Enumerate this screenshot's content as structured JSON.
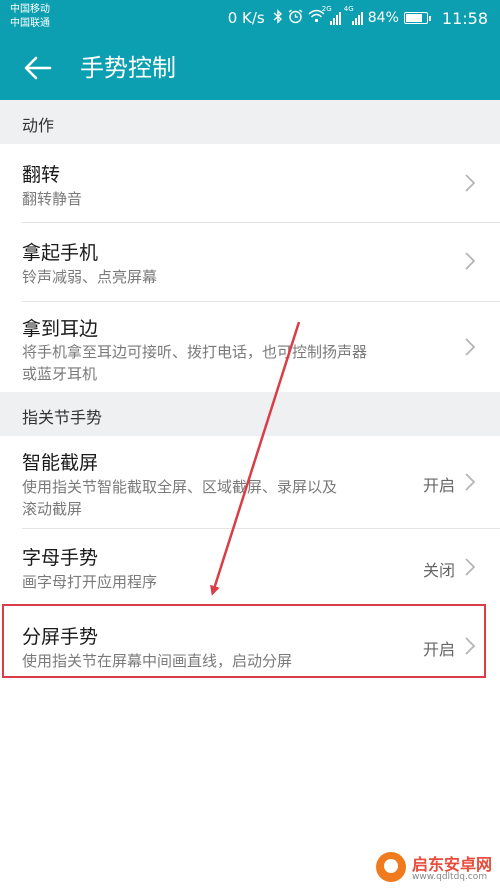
{
  "status_bar": {
    "carrier_1": "中国移动",
    "carrier_2": "中国联通",
    "speed": "0 K/s",
    "net_2g": "2G",
    "net_4g": "4G",
    "battery_percent": "84%",
    "battery_level": 0.84,
    "time": "11:58",
    "icons": [
      "bluetooth-icon",
      "alarm-icon",
      "wifi-icon",
      "signal-icon",
      "battery-icon"
    ]
  },
  "header": {
    "title": "手势控制",
    "background": "#0c9fb1"
  },
  "sections": [
    {
      "header": "动作",
      "items": [
        {
          "title": "翻转",
          "subtitle": "翻转静音"
        },
        {
          "title": "拿起手机",
          "subtitle": "铃声减弱、点亮屏幕"
        },
        {
          "title": "拿到耳边",
          "subtitle_line1": "将手机拿至耳边可接听、拨打电话，也可控制扬声器",
          "subtitle_line2": "或蓝牙耳机"
        }
      ]
    },
    {
      "header": "指关节手势",
      "items": [
        {
          "title": "智能截屏",
          "subtitle_line1": "使用指关节智能截取全屏、区域截屏、录屏以及",
          "subtitle_line2": "滚动截屏",
          "value": "开启"
        },
        {
          "title": "字母手势",
          "subtitle": "画字母打开应用程序",
          "value": "关闭"
        },
        {
          "title": "分屏手势",
          "subtitle": "使用指关节在屏幕中间画直线，启动分屏",
          "value": "开启"
        }
      ]
    }
  ],
  "annotation": {
    "color": "#d93d47"
  },
  "watermark": {
    "name": "启东安卓网",
    "url": "www.qdltdq.com"
  }
}
